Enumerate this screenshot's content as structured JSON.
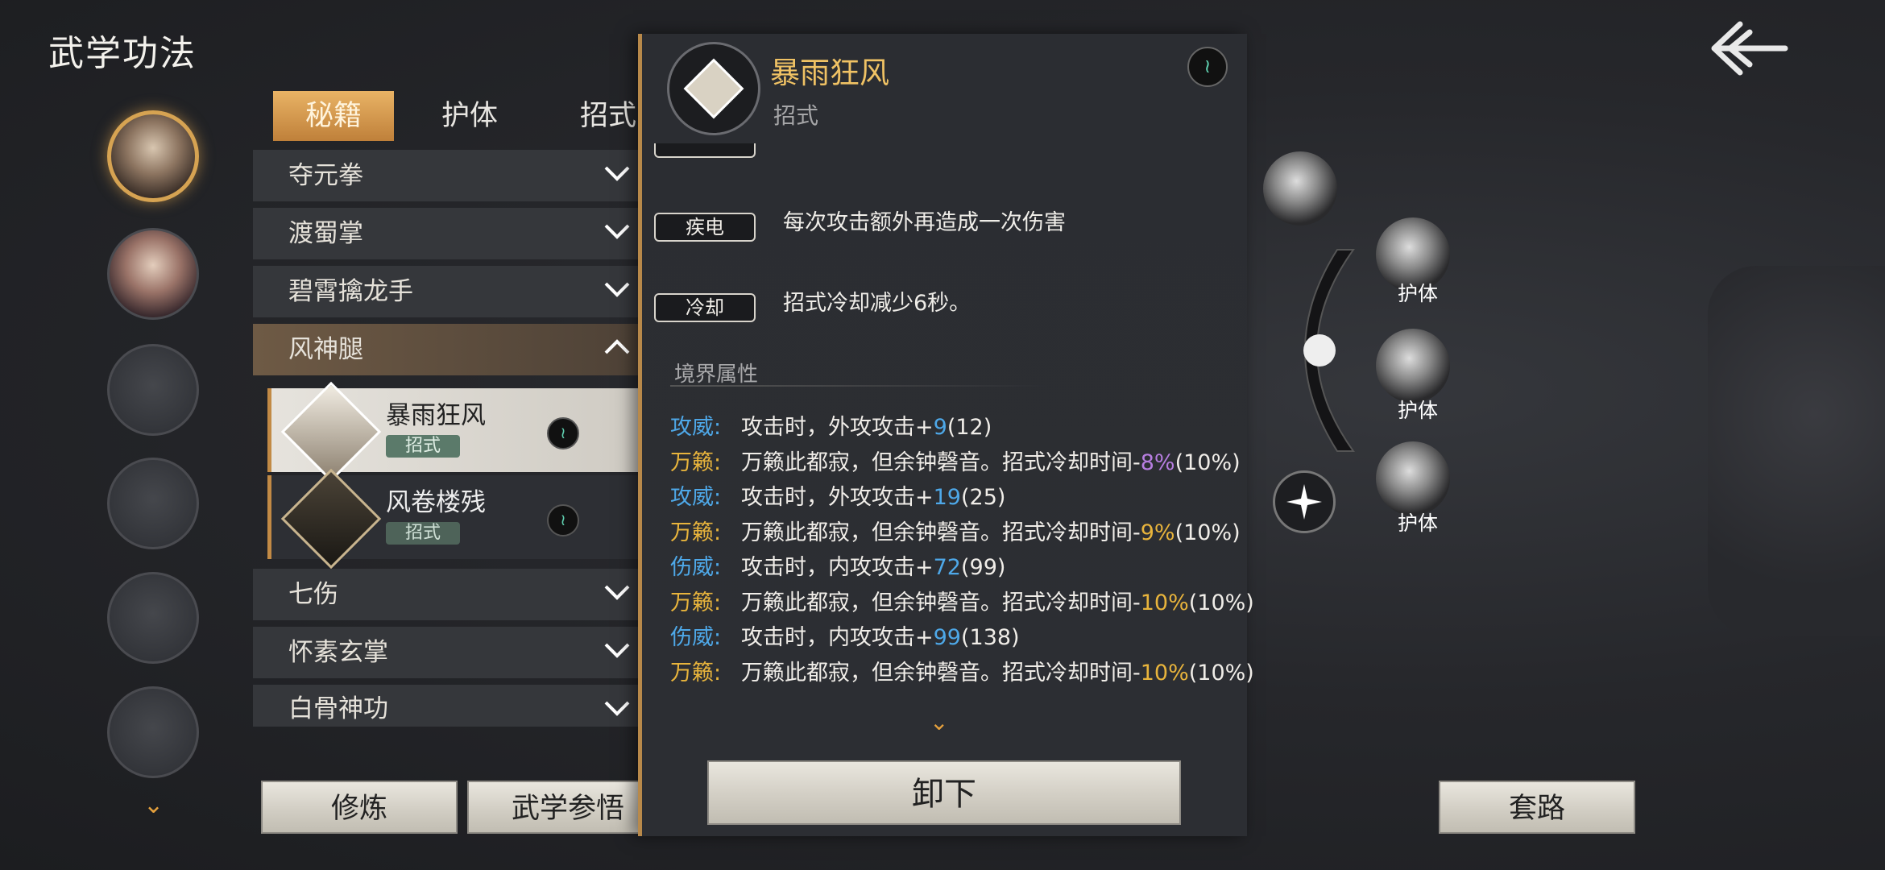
{
  "header": {
    "title": "武学功法"
  },
  "tabs": [
    {
      "label": "秘籍",
      "active": true
    },
    {
      "label": "护体",
      "active": false
    },
    {
      "label": "招式",
      "active": false
    }
  ],
  "martial_list": [
    {
      "label": "夺元拳",
      "expanded": false
    },
    {
      "label": "渡蜀掌",
      "expanded": false
    },
    {
      "label": "碧霄擒龙手",
      "expanded": false
    },
    {
      "label": "风神腿",
      "expanded": true
    },
    {
      "label": "七伤",
      "expanded": false
    },
    {
      "label": "怀素玄掌",
      "expanded": false
    },
    {
      "label": "白骨神功",
      "expanded": false
    }
  ],
  "sub_skills": [
    {
      "name": "暴雨狂风",
      "tag": "招式",
      "selected": true
    },
    {
      "name": "风卷楼残",
      "tag": "招式",
      "selected": false
    }
  ],
  "bottom_buttons": {
    "train": "修炼",
    "comprehend": "武学参悟",
    "unequip": "卸下",
    "routine": "套路"
  },
  "detail": {
    "name": "暴雨狂风",
    "type": "招式",
    "effects": [
      {
        "tag": "疾电",
        "text": "每次攻击额外再造成一次伤害"
      },
      {
        "tag": "冷却",
        "text": "招式冷却减少6秒。"
      }
    ],
    "realm_title": "境界属性",
    "attributes": [
      {
        "key": "攻威",
        "desc": "攻击时，外攻攻击+",
        "delta": "9",
        "paren": "(12)",
        "key_color": "#4ea8e8",
        "delta_color": "#4ea8e8"
      },
      {
        "key": "万籁",
        "desc": "万籁此都寂，但余钟磬音。招式冷却时间-",
        "delta": "8%",
        "paren": "(10%)",
        "key_color": "#e8b43c",
        "delta_color": "#b77ee0"
      },
      {
        "key": "攻威",
        "desc": "攻击时，外攻攻击+",
        "delta": "19",
        "paren": "(25)",
        "key_color": "#4ea8e8",
        "delta_color": "#4ea8e8"
      },
      {
        "key": "万籁",
        "desc": "万籁此都寂，但余钟磬音。招式冷却时间-",
        "delta": "9%",
        "paren": "(10%)",
        "key_color": "#e8b43c",
        "delta_color": "#e8b43c"
      },
      {
        "key": "伤威",
        "desc": "攻击时，内攻攻击+",
        "delta": "72",
        "paren": "(99)",
        "key_color": "#4ea8e8",
        "delta_color": "#4ea8e8"
      },
      {
        "key": "万籁",
        "desc": "万籁此都寂，但余钟磬音。招式冷却时间-",
        "delta": "10%",
        "paren": "(10%)",
        "key_color": "#e8b43c",
        "delta_color": "#e8b43c"
      },
      {
        "key": "伤威",
        "desc": "攻击时，内攻攻击+",
        "delta": "99",
        "paren": "(138)",
        "key_color": "#4ea8e8",
        "delta_color": "#4ea8e8"
      },
      {
        "key": "万籁",
        "desc": "万籁此都寂，但余钟磬音。招式冷却时间-",
        "delta": "10%",
        "paren": "(10%)",
        "key_color": "#e8b43c",
        "delta_color": "#e8b43c"
      }
    ]
  },
  "wheel": {
    "slot_labels": [
      "护体",
      "护体",
      "护体"
    ]
  },
  "colors": {
    "accent_gold": "#d6a352",
    "tab_active": "#e9b365"
  }
}
